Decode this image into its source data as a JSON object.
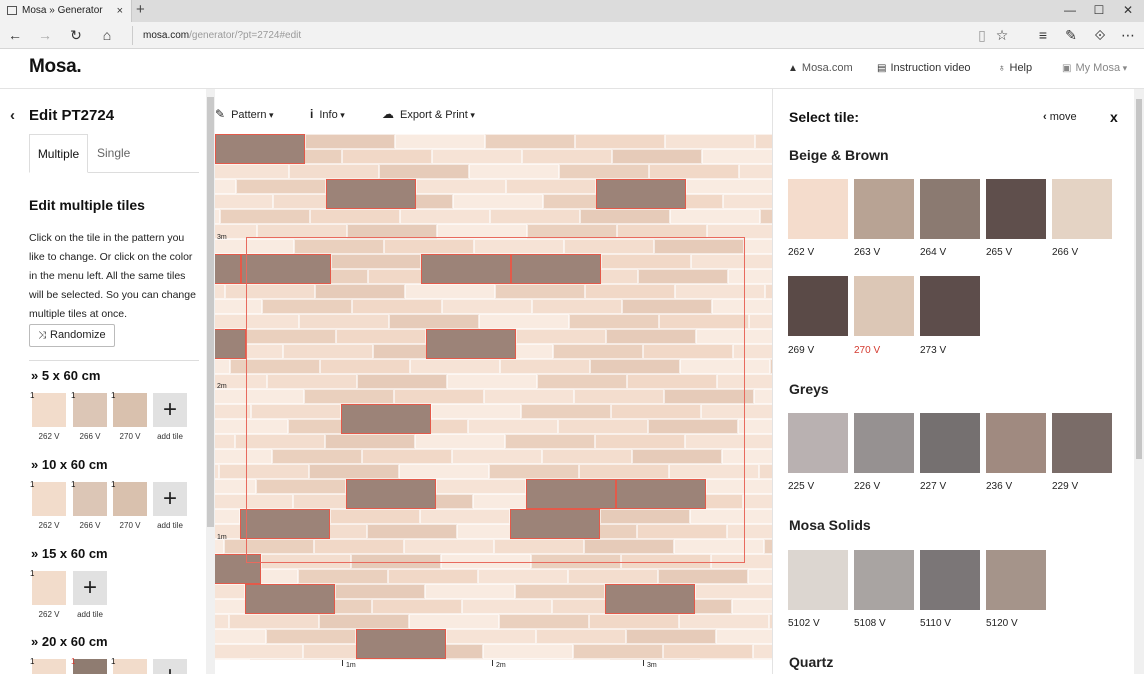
{
  "browser": {
    "tab_title": "Mosa » Generator",
    "tab_close": "×",
    "new_tab": "+",
    "url_host": "mosa.com",
    "url_path": "/generator/?pt=2724#edit",
    "window_controls": [
      "—",
      "☐",
      "✕"
    ]
  },
  "header": {
    "logo": "Mosa.",
    "links": {
      "site": "Mosa.com",
      "video": "Instruction video",
      "help": "Help",
      "account": "My Mosa"
    }
  },
  "left": {
    "title": "Edit PT2724",
    "tabs": [
      "Multiple",
      "Single"
    ],
    "section_title": "Edit multiple tiles",
    "description": "Click on the tile in the pattern you like to change. Or click on the color in the menu left. All the same tiles will be selected. So you can change multiple tiles at once.",
    "randomize": "Randomize",
    "add_tile": "add tile",
    "sizes": [
      {
        "title": "» 5 x 60 cm",
        "tiles": [
          {
            "count": "1",
            "code": "262 V",
            "color": "#f2dccb"
          },
          {
            "count": "1",
            "code": "266 V",
            "color": "#dcc6b6"
          },
          {
            "count": "1",
            "code": "270 V",
            "color": "#d9c1ae"
          }
        ]
      },
      {
        "title": "» 10 x 60 cm",
        "tiles": [
          {
            "count": "1",
            "code": "262 V",
            "color": "#f2dccb"
          },
          {
            "count": "1",
            "code": "266 V",
            "color": "#dcc6b6"
          },
          {
            "count": "1",
            "code": "270 V",
            "color": "#d9c1ae"
          }
        ]
      },
      {
        "title": "» 15 x 60 cm",
        "tiles": [
          {
            "count": "1",
            "code": "262 V",
            "color": "#f2dccb"
          }
        ]
      },
      {
        "title": "» 20 x 60 cm",
        "tiles": [
          {
            "count": "1",
            "code": "",
            "color": "#f2dccb"
          },
          {
            "count": "1",
            "code": "",
            "color": "#8f7c71",
            "red": true
          },
          {
            "count": "1",
            "code": "",
            "color": "#f2dccb"
          }
        ]
      }
    ]
  },
  "toolbar": {
    "pattern": "Pattern",
    "info": "Info",
    "export": "Export & Print"
  },
  "rulers": {
    "vertical": [
      "3m",
      "2m",
      "1m"
    ],
    "horizontal": [
      "1m",
      "2m",
      "3m"
    ]
  },
  "right": {
    "title": "Select tile:",
    "move": "move",
    "close": "x",
    "groups": [
      {
        "title": "Beige & Brown",
        "tiles": [
          {
            "code": "262 V",
            "color": "#f4dccc"
          },
          {
            "code": "263 V",
            "color": "#b8a394"
          },
          {
            "code": "264 V",
            "color": "#8b7a71"
          },
          {
            "code": "265 V",
            "color": "#5f4f4c"
          },
          {
            "code": "266 V",
            "color": "#e4d3c4"
          },
          {
            "code": "269 V",
            "color": "#5a4a47"
          },
          {
            "code": "270 V",
            "color": "#dcc7b6",
            "selected": true
          },
          {
            "code": "273 V",
            "color": "#5d4d4b"
          }
        ]
      },
      {
        "title": "Greys",
        "tiles": [
          {
            "code": "225 V",
            "color": "#b9b1b1"
          },
          {
            "code": "226 V",
            "color": "#969191"
          },
          {
            "code": "227 V",
            "color": "#757070"
          },
          {
            "code": "236 V",
            "color": "#a08a80"
          },
          {
            "code": "229 V",
            "color": "#7a6c68"
          }
        ]
      },
      {
        "title": "Mosa Solids",
        "tiles": [
          {
            "code": "5102 V",
            "color": "#dcd6d0"
          },
          {
            "code": "5108 V",
            "color": "#a9a4a2"
          },
          {
            "code": "5110 V",
            "color": "#7b7677"
          },
          {
            "code": "5120 V",
            "color": "#a5948a"
          }
        ]
      },
      {
        "title": "Quartz",
        "tiles": []
      }
    ]
  },
  "colors": {
    "accent": "#d43a2f",
    "tile_light": "#f4dccc",
    "tile_mid": "#e9cbb9",
    "tile_dark": "#9b8276",
    "selection": "#e35a4a"
  }
}
